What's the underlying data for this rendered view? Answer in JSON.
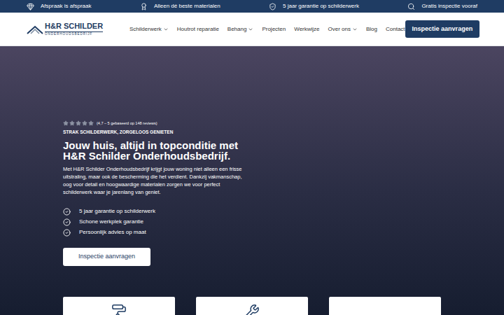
{
  "top_bar": [
    {
      "label": "Afspraak is afspraak"
    },
    {
      "label": "Alleen dé beste materialen"
    },
    {
      "label": "5 jaar garantie op schilderwerk"
    },
    {
      "label": "Gratis inspectie vooraf"
    }
  ],
  "logo": {
    "name": "H&R SCHILDER",
    "subtitle": "ONDERHOUDSBEDRIJF"
  },
  "nav": [
    {
      "label": "Schilderwerk",
      "dropdown": true
    },
    {
      "label": "Houtrot reparatie",
      "dropdown": false
    },
    {
      "label": "Behang",
      "dropdown": true
    },
    {
      "label": "Projecten",
      "dropdown": false
    },
    {
      "label": "Werkwijze",
      "dropdown": false
    },
    {
      "label": "Over ons",
      "dropdown": true
    },
    {
      "label": "Blog",
      "dropdown": false
    },
    {
      "label": "Contact",
      "dropdown": false
    }
  ],
  "header_button": "Inspectie aanvragen",
  "hero": {
    "stars": 5,
    "rating": "(4,7 – 5 gebaseerd op 148 reviews)",
    "eyebrow": "STRAK SCHILDERWERK, ZORGELOOS GENIETEN",
    "title": "Jouw huis, altijd in topconditie met H&R Schilder Onderhoudsbedrijf.",
    "text": "Met H&R Schilder Onderhoudsbedrijf krijgt jouw woning niet alleen een frisse uitstraling, maar ook de bescherming die het verdient. Dankzij vakmanschap, oog voor detail en hoogwaardige materialen zorgen we voor perfect schilderwerk waar je jarenlang van geniet.",
    "checks": [
      "5 jaar garantie op schilderwerk",
      "Schone werkplek garantie",
      "Persoonlijk advies op maat"
    ],
    "button": "Inspectie aanvragen"
  }
}
